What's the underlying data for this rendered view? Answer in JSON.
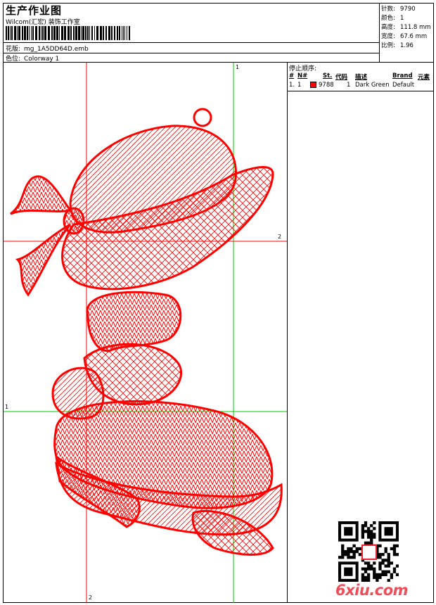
{
  "header": {
    "title": "生产作业图",
    "company": "Wilcom(汇宏) 装饰工作室",
    "design_label": "花版:",
    "design_value": "mg_1A5DD64D.emb",
    "colorway_label": "色位:",
    "colorway_value": "Colorway 1"
  },
  "stats": [
    {
      "label": "针数:",
      "value": "9790"
    },
    {
      "label": "颜色:",
      "value": "1"
    },
    {
      "label": "高度:",
      "value": "111.8 mm"
    },
    {
      "label": "宽度:",
      "value": "67.6 mm"
    },
    {
      "label": "比例:",
      "value": "1.96"
    }
  ],
  "stop_sequence": {
    "title": "停止顺序:",
    "columns": [
      "#",
      "N#",
      "St.",
      "代码",
      "描述",
      "Brand",
      "元素"
    ],
    "rows": [
      {
        "num": "1.",
        "needle": "1",
        "stitch": "9788",
        "code": "1",
        "description": "Dark Green",
        "brand": "Default",
        "element": "",
        "color": "#ff0000"
      }
    ]
  },
  "guides": {
    "top": "1",
    "right": "2",
    "left": "1",
    "bottom": "2"
  },
  "watermark": {
    "text": "6xiu.com",
    "seal_text": "六秀"
  },
  "colors": {
    "stitch": "#ff0000",
    "guide_green": "#00cc00",
    "guide_red": "#ff0000",
    "brand": "#ee4d5a"
  }
}
